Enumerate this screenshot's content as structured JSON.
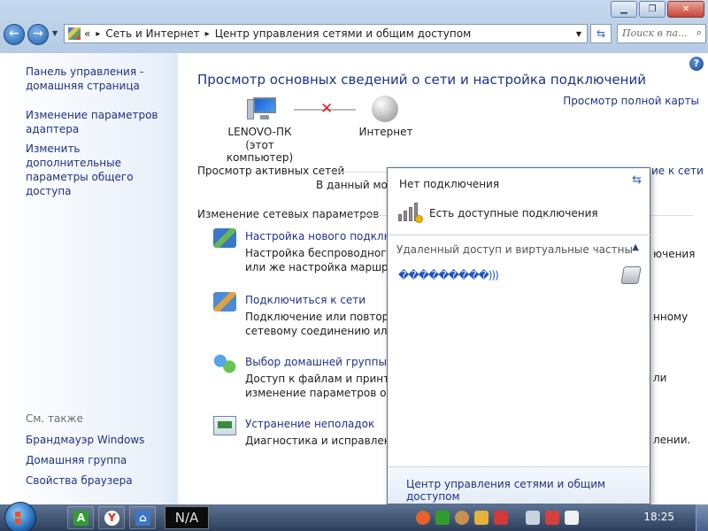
{
  "window": {
    "nav_back": "←",
    "nav_fwd": "→",
    "minimize": "▁",
    "maximize": "❐",
    "close": "✕"
  },
  "address": {
    "prefix": "«",
    "crumb1": "Сеть и Интернет",
    "crumb2": "Центр управления сетями и общим доступом",
    "sep": "▸"
  },
  "search": {
    "placeholder": "Поиск в па..."
  },
  "sidebar": {
    "items": [
      "Панель управления -\nдомашняя страница",
      "Изменение параметров\nадаптера",
      "Изменить дополнительные\nпараметры общего доступа"
    ],
    "see_also": "См. также",
    "also_items": [
      "Брандмауэр Windows",
      "Домашняя группа",
      "Свойства браузера"
    ]
  },
  "main": {
    "title": "Просмотр основных сведений о сети и настройка подключений",
    "full_map": "Просмотр полной карты",
    "computer_name": "LENOVO-ПК",
    "computer_sub": "(этот компьютер)",
    "internet": "Интернет",
    "active_networks": "Просмотр активных сетей",
    "active_right": "ие к сети",
    "no_networks_fragment": "В данный мом",
    "change_settings": "Изменение сетевых параметров",
    "tasks": [
      {
        "title": "Настройка нового подключе",
        "desc1": "Настройка беспроводного, ш",
        "desc2": "или же настройка маршрути",
        "right1": "ючения",
        "right2": ""
      },
      {
        "title": "Подключиться к сети",
        "desc1": "Подключение или повторноe",
        "desc2": "сетевому соединению или п",
        "right1": "нному",
        "right2": ""
      },
      {
        "title": "Выбор домашней группы и п",
        "desc1": "Доступ к файлам и принтера",
        "desc2": "изменение параметров обще",
        "right1": "ли",
        "right2": ""
      },
      {
        "title": "Устранение неполадок",
        "desc1": "Диагностика и исправление",
        "desc2": "",
        "right1": "лении.",
        "right2": ""
      }
    ]
  },
  "flyout": {
    "status": "Нет подключения",
    "available": "Есть доступные подключения",
    "group": "Удаленный доступ и виртуальные частные се...",
    "item": "���������)))",
    "footer_link": "Центр управления сетями и общим доступом"
  },
  "taskbar": {
    "na_label": "N/A",
    "clock": "18:25"
  },
  "colors": {
    "link": "#1e3287",
    "accent": "#2a6ab2"
  }
}
